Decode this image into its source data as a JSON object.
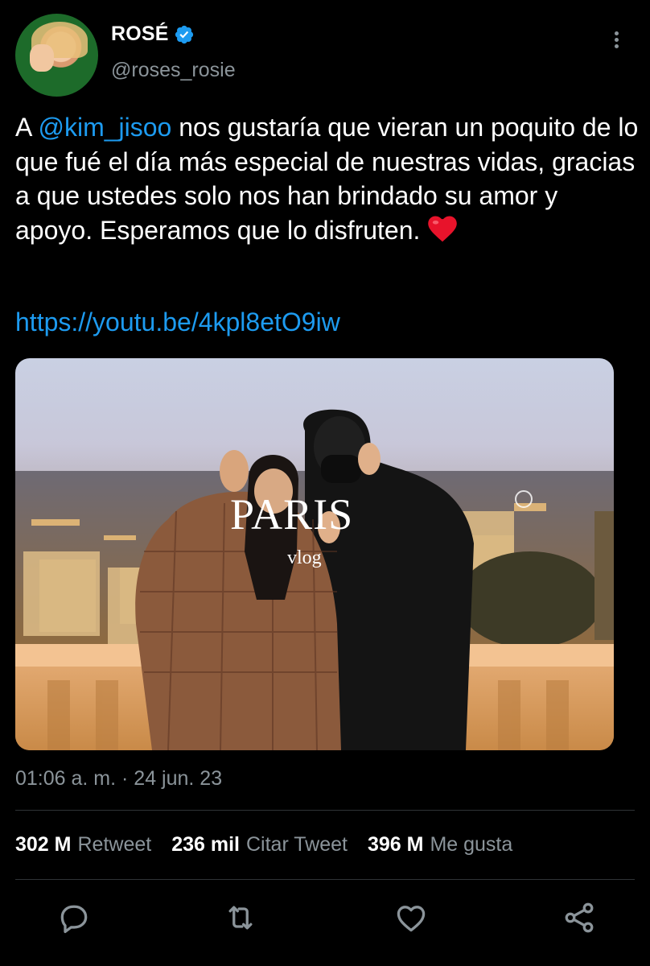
{
  "user": {
    "name": "ROSÉ",
    "handle": "@roses_rosie"
  },
  "tweet": {
    "prefix": "A ",
    "mention": "@kim_jisoo",
    "body": " nos gustaría que vieran un poquito de lo que fué el día más especial de nuestras vidas, gracias a que ustedes solo nos han brindado su amor y apoyo. Esperamos que lo disfruten. ",
    "link": "https://youtu.be/4kpl8etO9iw"
  },
  "media": {
    "title": "PARIS",
    "subtitle": "vlog"
  },
  "timestamp": "01:06 a. m. · 24 jun. 23",
  "stats": [
    {
      "count": "302 M",
      "label": "Retweet"
    },
    {
      "count": "236 mil",
      "label": "Citar Tweet"
    },
    {
      "count": "396 M",
      "label": "Me gusta"
    }
  ],
  "icons": {
    "verified": "verified-badge-icon",
    "more": "more-vertical-icon",
    "reply": "reply-icon",
    "retweet": "retweet-icon",
    "like": "heart-icon",
    "share": "share-icon",
    "emoji": "red-heart-emoji"
  },
  "colors": {
    "background": "#000000",
    "text": "#ffffff",
    "secondary": "#8b949a",
    "accent": "#1d9bf0",
    "divider": "#2f3336"
  }
}
